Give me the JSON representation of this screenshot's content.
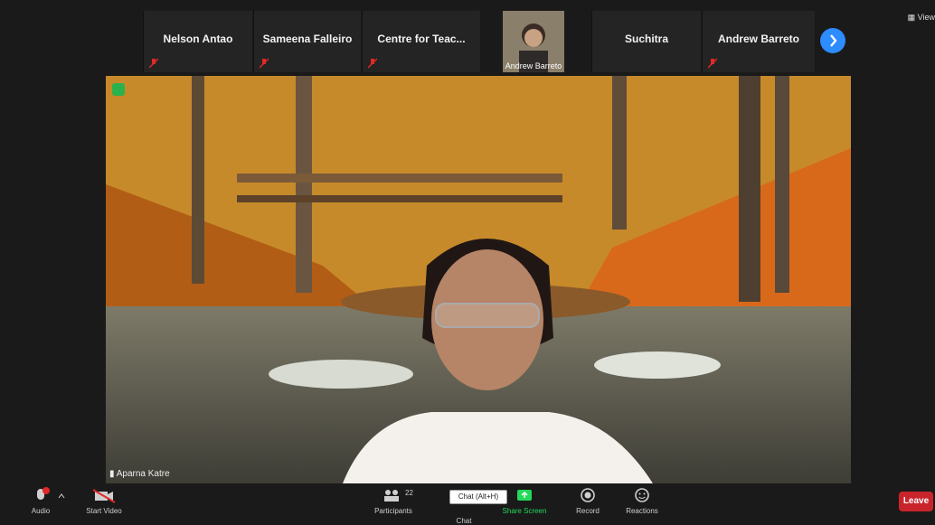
{
  "top_participants": [
    {
      "name": "Nelson Antao",
      "muted": true
    },
    {
      "name": "Sameena Falleiro",
      "muted": true
    },
    {
      "name": "Centre for Teac...",
      "muted": true
    },
    {
      "name": "Andrew Barreto",
      "video": true,
      "muted": false
    },
    {
      "name": "Suchitra",
      "muted": false
    },
    {
      "name": "Andrew Barreto",
      "muted": true
    }
  ],
  "view_label": "View",
  "main_speaker": {
    "name": "Aparna Katre"
  },
  "toolbar": {
    "audio": "Audio",
    "start_video": "Start Video",
    "participants": "Participants",
    "participants_count": "22",
    "chat": "Chat",
    "chat_tooltip": "Chat (Alt+H)",
    "share_screen": "Share Screen",
    "record": "Record",
    "reactions": "Reactions",
    "leave": "Leave"
  },
  "colors": {
    "accent": "#2d8cff",
    "leave": "#c9242b",
    "share": "#23d959"
  }
}
